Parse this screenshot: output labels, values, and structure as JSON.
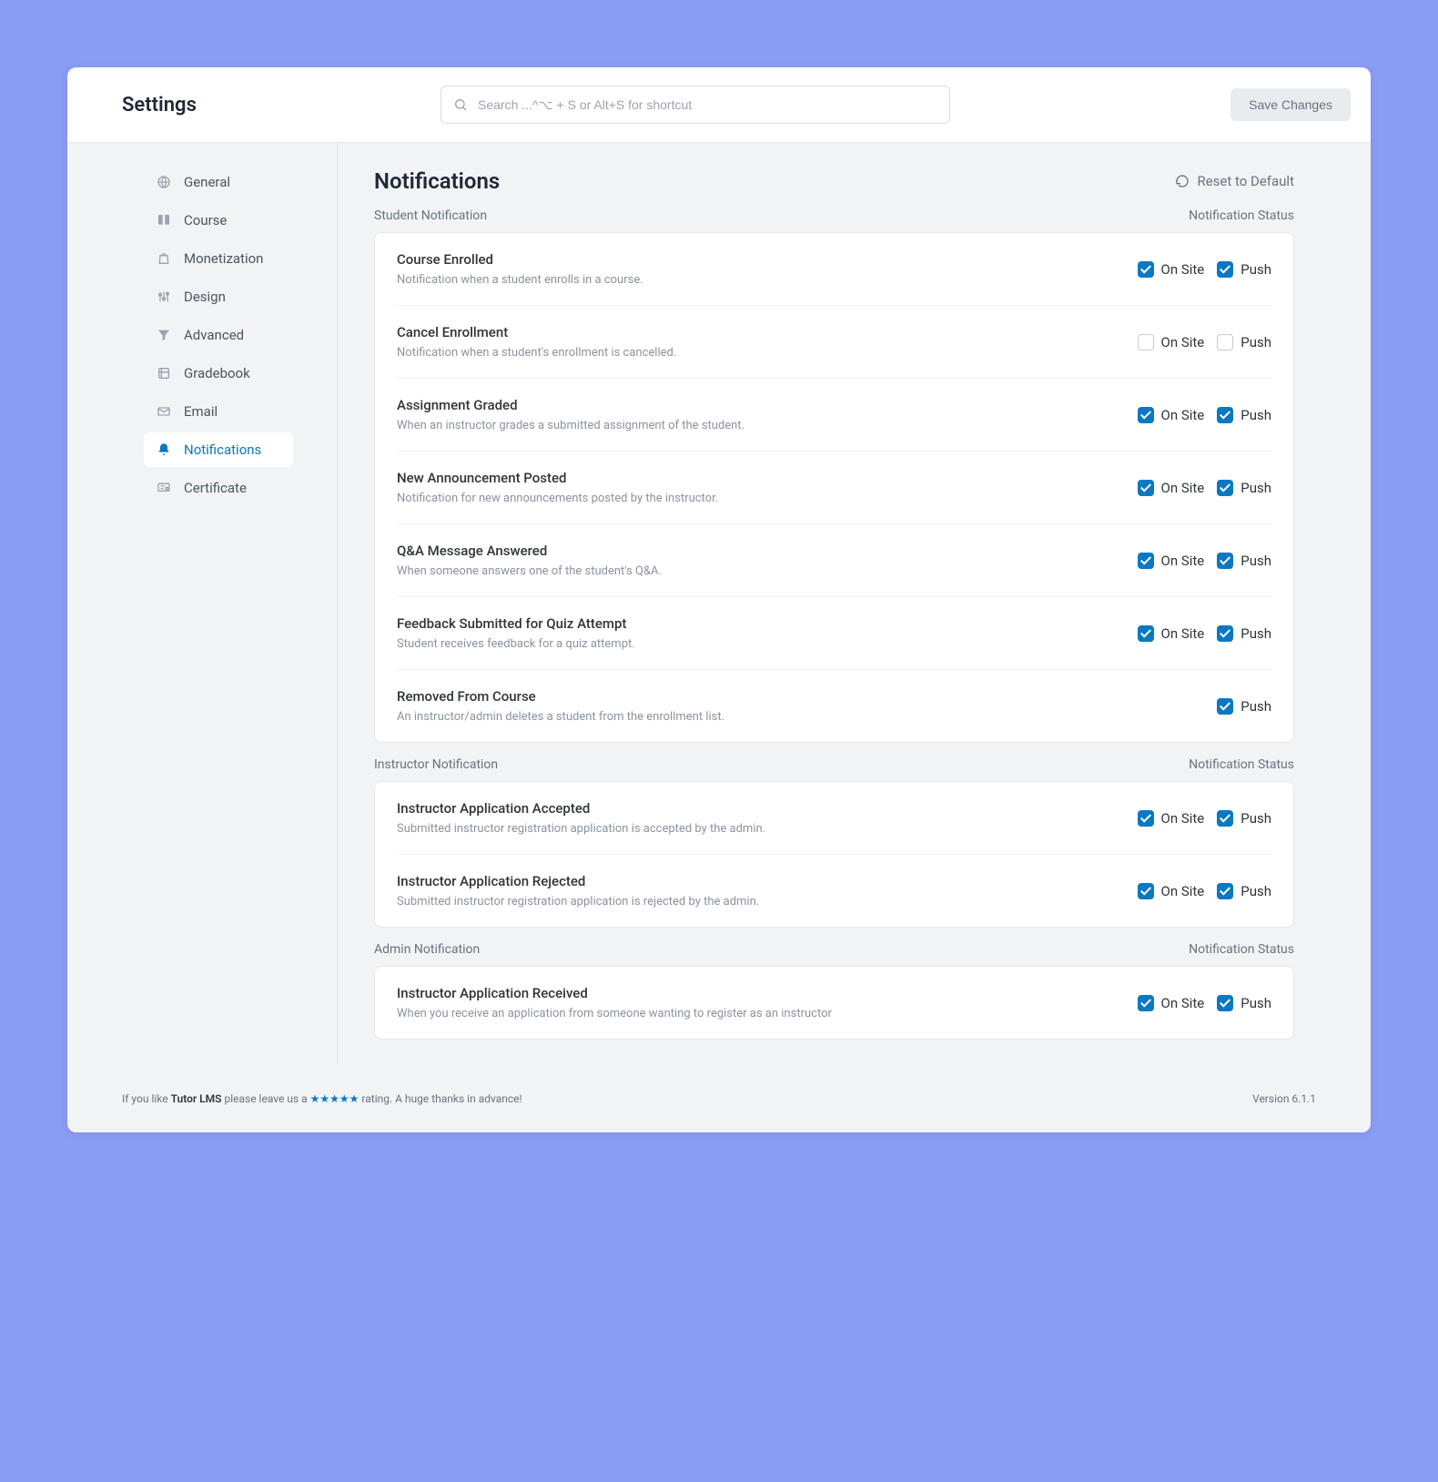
{
  "header": {
    "title": "Settings",
    "search_placeholder": "Search ...^⌥ + S or Alt+S for shortcut",
    "save_label": "Save Changes"
  },
  "sidebar": {
    "items": [
      {
        "label": "General",
        "icon": "globe-icon",
        "active": false
      },
      {
        "label": "Course",
        "icon": "book-icon",
        "active": false
      },
      {
        "label": "Monetization",
        "icon": "bag-icon",
        "active": false
      },
      {
        "label": "Design",
        "icon": "sliders-icon",
        "active": false
      },
      {
        "label": "Advanced",
        "icon": "funnel-icon",
        "active": false
      },
      {
        "label": "Gradebook",
        "icon": "gradebook-icon",
        "active": false
      },
      {
        "label": "Email",
        "icon": "mail-icon",
        "active": false
      },
      {
        "label": "Notifications",
        "icon": "bell-icon",
        "active": true
      },
      {
        "label": "Certificate",
        "icon": "certificate-icon",
        "active": false
      }
    ]
  },
  "page": {
    "title": "Notifications",
    "reset_label": "Reset to Default"
  },
  "labels": {
    "status_header": "Notification Status",
    "on_site": "On Site",
    "push": "Push"
  },
  "sections": [
    {
      "title": "Student Notification",
      "rows": [
        {
          "title": "Course Enrolled",
          "desc": "Notification when a student enrolls in a course.",
          "on_site": true,
          "push": true,
          "show_on_site": true
        },
        {
          "title": "Cancel Enrollment",
          "desc": "Notification when a student's enrollment is cancelled.",
          "on_site": false,
          "push": false,
          "show_on_site": true
        },
        {
          "title": "Assignment Graded",
          "desc": "When an instructor grades a submitted assignment of the student.",
          "on_site": true,
          "push": true,
          "show_on_site": true
        },
        {
          "title": "New Announcement Posted",
          "desc": "Notification for new announcements posted by the instructor.",
          "on_site": true,
          "push": true,
          "show_on_site": true
        },
        {
          "title": "Q&A Message Answered",
          "desc": "When someone answers one of the student's Q&A.",
          "on_site": true,
          "push": true,
          "show_on_site": true
        },
        {
          "title": "Feedback Submitted for Quiz Attempt",
          "desc": "Student receives feedback for a quiz attempt.",
          "on_site": true,
          "push": true,
          "show_on_site": true
        },
        {
          "title": "Removed From Course",
          "desc": "An instructor/admin deletes a student from the enrollment list.",
          "on_site": null,
          "push": true,
          "show_on_site": false
        }
      ]
    },
    {
      "title": "Instructor Notification",
      "rows": [
        {
          "title": "Instructor Application Accepted",
          "desc": "Submitted instructor registration application is accepted by the admin.",
          "on_site": true,
          "push": true,
          "show_on_site": true
        },
        {
          "title": "Instructor Application Rejected",
          "desc": "Submitted instructor registration application is rejected by the admin.",
          "on_site": true,
          "push": true,
          "show_on_site": true
        }
      ]
    },
    {
      "title": "Admin Notification",
      "rows": [
        {
          "title": "Instructor Application Received",
          "desc": "When you receive an application from someone wanting to register as an instructor",
          "on_site": true,
          "push": true,
          "show_on_site": true
        }
      ]
    }
  ],
  "footer": {
    "prefix": "If you like ",
    "product": "Tutor LMS",
    "mid": " please leave us a ",
    "stars": "★★★★★",
    "suffix": " rating. A huge thanks in advance!",
    "version": "Version 6.1.1"
  }
}
